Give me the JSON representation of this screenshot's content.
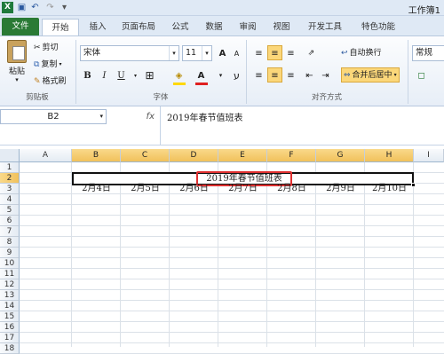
{
  "titlebar": {
    "title": "工作簿1",
    "qa_icons": [
      "excel-app-icon",
      "save-icon",
      "undo-icon",
      "redo-icon",
      "customize-icon"
    ]
  },
  "tabs": [
    "文件",
    "开始",
    "插入",
    "页面布局",
    "公式",
    "数据",
    "审阅",
    "视图",
    "开发工具",
    "特色功能"
  ],
  "clipboard": {
    "paste": "粘贴",
    "cut": "剪切",
    "copy": "复制",
    "format_painter": "格式刷",
    "group": "剪贴板"
  },
  "font": {
    "name": "宋体",
    "size": "11",
    "bold": "B",
    "italic": "I",
    "underline": "U",
    "font_color_label": "A",
    "grow": "A",
    "shrink": "A",
    "group": "字体"
  },
  "alignment": {
    "wrap": "自动换行",
    "merge": "合并后居中",
    "group": "对齐方式"
  },
  "number": {
    "format": "常规"
  },
  "formula_bar": {
    "name_box": "B2",
    "fx": "fx",
    "content": "2019年春节值班表"
  },
  "grid": {
    "columns": [
      "A",
      "B",
      "C",
      "D",
      "E",
      "F",
      "G",
      "H",
      "I"
    ],
    "rows": [
      "1",
      "2",
      "3",
      "4",
      "5",
      "6",
      "7",
      "8",
      "9",
      "10",
      "11",
      "12",
      "13",
      "14",
      "15",
      "16",
      "17",
      "18"
    ],
    "merged_title": "2019年春节值班表",
    "dates": [
      "2月4日",
      "2月5日",
      "2月6日",
      "2月7日",
      "2月8日",
      "2月9日",
      "2月10日"
    ]
  },
  "colors": {
    "accent": "#2a7a35",
    "highlight": "#e03030",
    "selection": "#f1c15b"
  }
}
